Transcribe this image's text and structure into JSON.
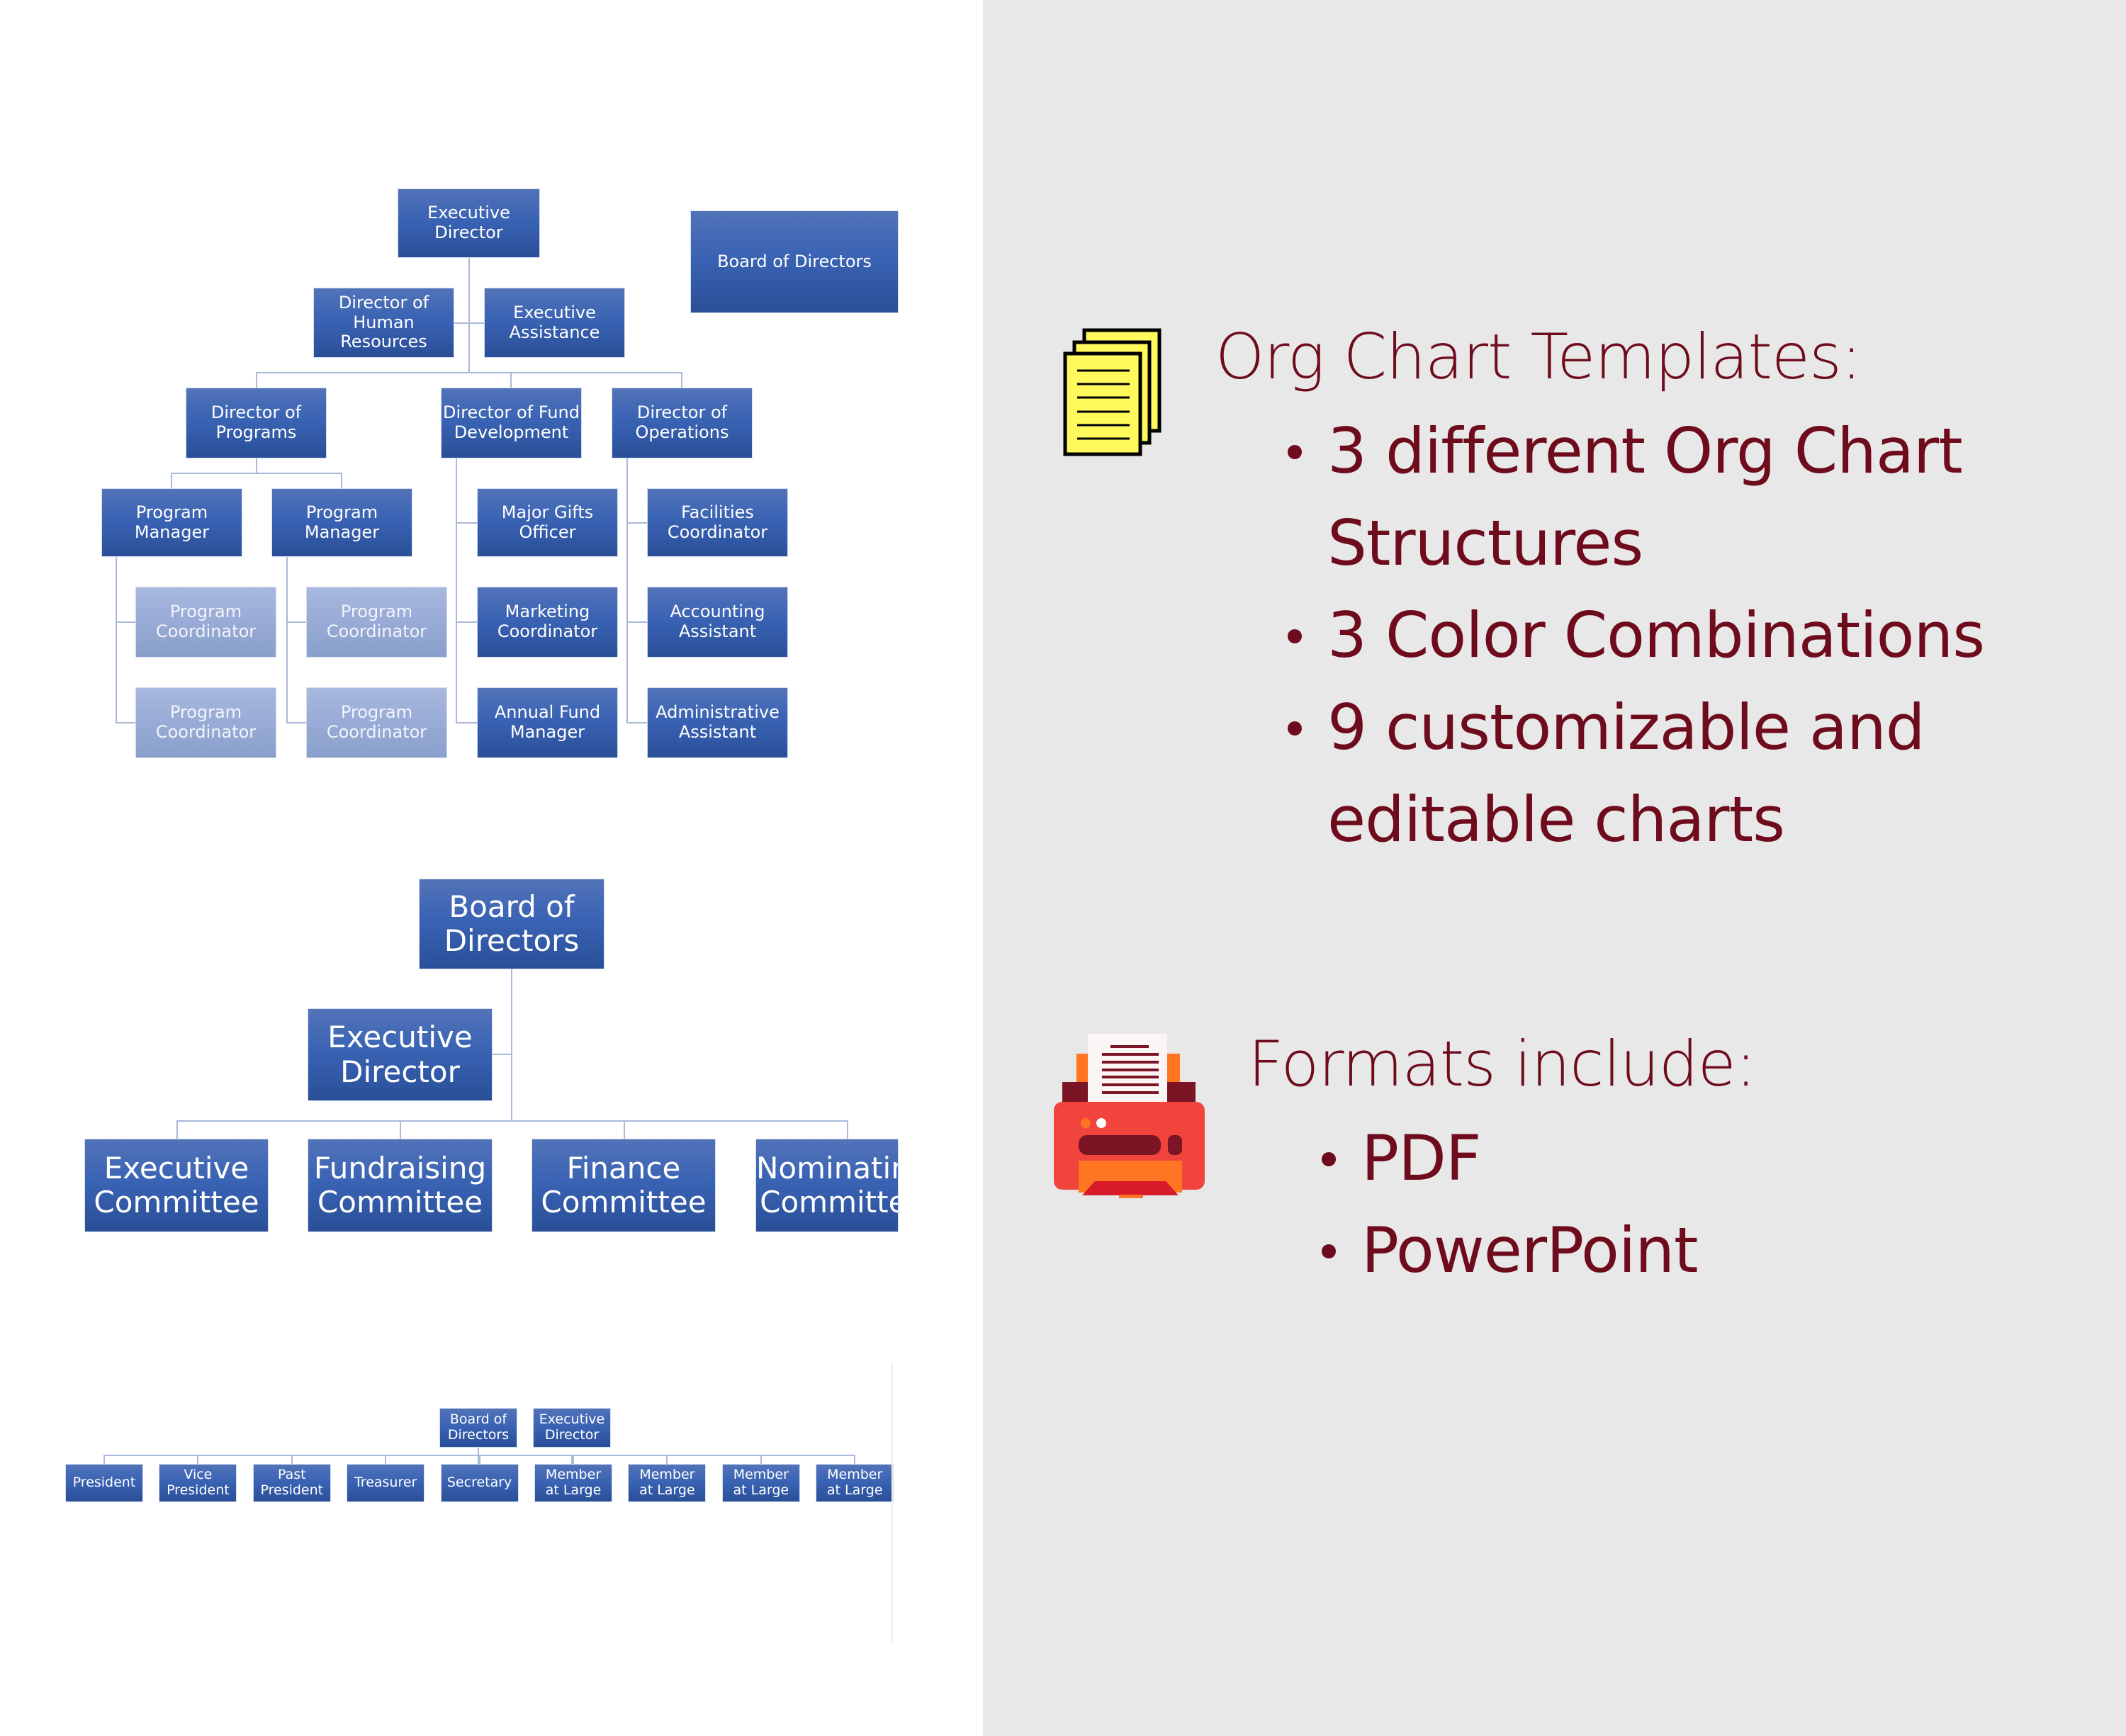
{
  "colors": {
    "text_accent": "#6e0b1c",
    "box_dark": "#2a4f98",
    "box_light": "#5273b8",
    "box_faded": "#98abd6",
    "right_bg": "#e8e8e8",
    "left_bg": "#ffffff"
  },
  "charts": {
    "chart1": {
      "executive_director": "Executive\nDirector",
      "board_of_directors": "Board of Directors",
      "director_hr": "Director of\nHuman\nResources",
      "executive_assistance": "Executive\nAssistance",
      "directors": [
        "Director of\nPrograms",
        "Director of Fund\nDevelopment",
        "Director of\nOperations"
      ],
      "program_managers": [
        "Program\nManager",
        "Program\nManager"
      ],
      "program_coordinators": [
        "Program\nCoordinator",
        "Program\nCoordinator",
        "Program\nCoordinator",
        "Program\nCoordinator"
      ],
      "fund_dev_staff": [
        "Major Gifts\nOfficer",
        "Marketing\nCoordinator",
        "Annual Fund\nManager"
      ],
      "operations_staff": [
        "Facilities\nCoordinator",
        "Accounting\nAssistant",
        "Administrative\nAssistant"
      ]
    },
    "chart2": {
      "board_of_directors": "Board of\nDirectors",
      "executive_director": "Executive\nDirector",
      "committees": [
        "Executive\nCommittee",
        "Fundraising\nCommittee",
        "Finance\nCommittee",
        "Nominating\nCommittee"
      ]
    },
    "chart3": {
      "board_of_directors": "Board of\nDirectors",
      "executive_director": "Executive\nDirector",
      "officers": [
        "President",
        "Vice\nPresident",
        "Past\nPresident",
        "Treasurer",
        "Secretary",
        "Member\nat Large",
        "Member\nat Large",
        "Member\nat Large",
        "Member\nat Large"
      ]
    }
  },
  "features": {
    "icon": "documents-stack-icon",
    "heading": "Org Chart Templates:",
    "bullets": [
      "3 different Org Chart Structures",
      "3 Color Combinations",
      "9 customizable and editable charts"
    ]
  },
  "formats": {
    "icon": "printer-icon",
    "heading": "Formats include:",
    "bullets": [
      "PDF",
      "PowerPoint"
    ]
  }
}
